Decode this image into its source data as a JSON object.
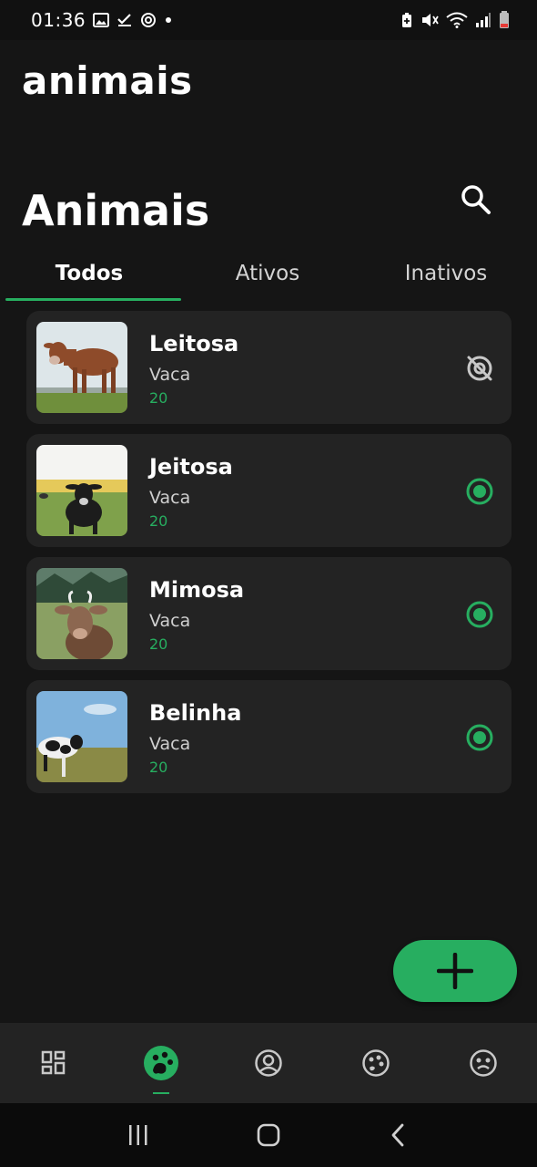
{
  "status_bar": {
    "time": "01:36",
    "left_icons": [
      "gallery-icon",
      "check-icon",
      "sync-icon",
      "dot-icon"
    ],
    "right_icons": [
      "battery-saver-icon",
      "mute-icon",
      "wifi-icon",
      "signal-icon",
      "battery-icon"
    ]
  },
  "app": {
    "title": "animais"
  },
  "page": {
    "section_title": "Animais",
    "search_icon": "search-icon"
  },
  "tabs": [
    {
      "label": "Todos",
      "active": true
    },
    {
      "label": "Ativos",
      "active": false
    },
    {
      "label": "Inativos",
      "active": false
    }
  ],
  "animals": [
    {
      "name": "Leitosa",
      "species": "Vaca",
      "age": "20",
      "status": "inactive",
      "status_icon": "inactive-icon"
    },
    {
      "name": "Jeitosa",
      "species": "Vaca",
      "age": "20",
      "status": "active",
      "status_icon": "active-radio-icon"
    },
    {
      "name": "Mimosa",
      "species": "Vaca",
      "age": "20",
      "status": "active",
      "status_icon": "active-radio-icon"
    },
    {
      "name": "Belinha",
      "species": "Vaca",
      "age": "20",
      "status": "active",
      "status_icon": "active-radio-icon"
    }
  ],
  "fab": {
    "icon": "plus-icon"
  },
  "bottom_nav": [
    {
      "icon": "dashboard-icon",
      "active": false
    },
    {
      "icon": "animals-icon",
      "active": true
    },
    {
      "icon": "profile-icon",
      "active": false
    },
    {
      "icon": "palette-icon",
      "active": false
    },
    {
      "icon": "face-icon",
      "active": false
    }
  ],
  "system_nav": [
    "recents-icon",
    "home-icon",
    "back-icon"
  ],
  "colors": {
    "accent": "#27ae60",
    "background": "#151515",
    "card": "#232323",
    "nav": "#232323"
  }
}
